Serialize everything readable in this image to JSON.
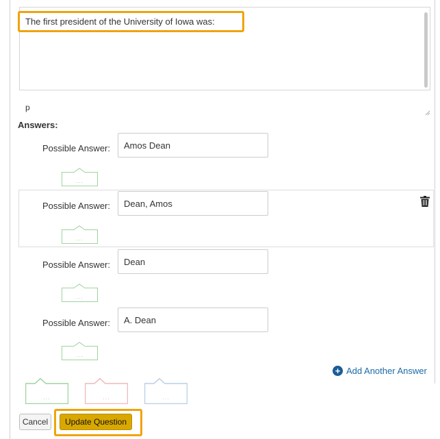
{
  "question": {
    "text": "The first president of the University of Iowa was:",
    "path_label": "p"
  },
  "answers_heading": "Answers:",
  "answers": [
    {
      "label": "Possible Answer:",
      "value": "Amos Dean"
    },
    {
      "label": "Possible Answer:",
      "value": "Dean, Amos"
    },
    {
      "label": "Possible Answer:",
      "value": "Dean"
    },
    {
      "label": "Possible Answer:",
      "value": "A. Dean"
    }
  ],
  "comment_placeholder": "...",
  "add_answer_label": "Add Another Answer",
  "buttons": {
    "cancel": "Cancel",
    "update": "Update Question"
  },
  "colors": {
    "highlight": "#f0a30a",
    "update_button": "#d9a800",
    "link": "#1a6aa8",
    "comment_green": "#9fd39f",
    "comment_red": "#f2b8b8",
    "comment_blue": "#b9cfe8"
  },
  "icons": {
    "trash": "trash-icon",
    "add": "plus-circle-icon",
    "resize": "resize-grip-icon"
  }
}
